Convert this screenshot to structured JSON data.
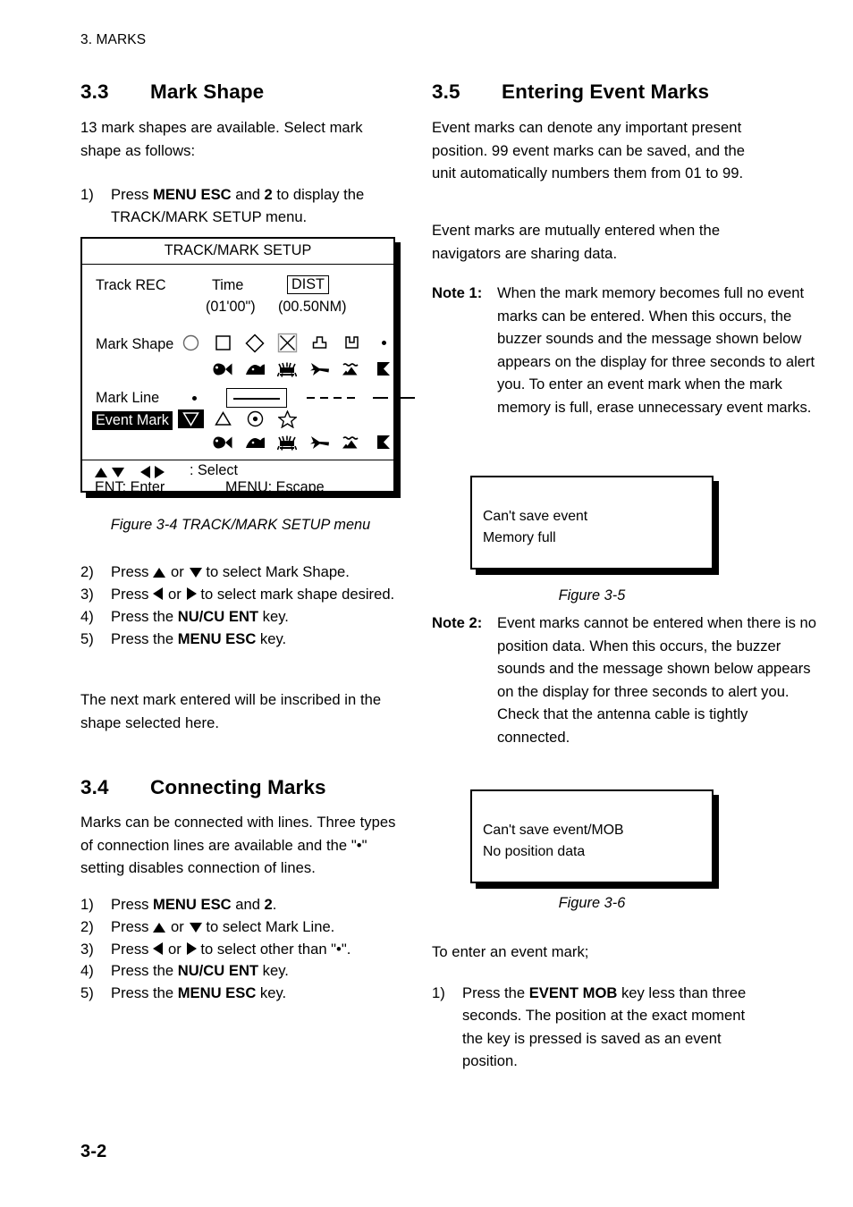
{
  "page": {
    "running_header": "3. MARKS",
    "page_number": "3-2"
  },
  "left_column": {
    "section_33": {
      "number": "3.3",
      "title": "Mark Shape",
      "intro": "13 mark shapes are available. Select mark shape as follows:",
      "step1_number": "1)",
      "step1_a": "Press ",
      "step1_b1": "MENU ESC",
      "step1_c": " and ",
      "step1_b2": "2",
      "step1_d": " to display the TRACK/MARK SETUP menu.",
      "figure_caption": "Figure 3-4 TRACK/MARK SETUP menu",
      "steps": [
        {
          "n": "2)",
          "pre": "Press ",
          "post": " to select Mark Shape.",
          "arrows": "up_or_down"
        },
        {
          "n": "3)",
          "pre": "Press ",
          "post": " to select mark shape desired.",
          "arrows": "left_or_right"
        },
        {
          "n": "4)",
          "pre": "Press the ",
          "bold": "NU/CU ENT",
          "post": " key."
        },
        {
          "n": "5)",
          "pre": "Press the ",
          "bold": "MENU ESC",
          "post": " key."
        }
      ],
      "outro": "The next mark entered will be inscribed in the shape selected here."
    },
    "section_34": {
      "number": "3.4",
      "title": "Connecting Marks",
      "intro": "Marks can be connected with lines. Three types of connection lines are available and the \"•\" setting disables connection of lines.",
      "steps": [
        {
          "n": "1)",
          "pre": "Press ",
          "bold": "MENU ESC",
          "post": " and ",
          "bold2": "2",
          "post2": "."
        },
        {
          "n": "2)",
          "pre": "Press ",
          "post": " to select Mark Line.",
          "arrows": "up_or_down"
        },
        {
          "n": "3)",
          "pre": "Press ",
          "post": " to select other than \"•\".",
          "arrows": "left_or_right"
        },
        {
          "n": "4)",
          "pre": "Press the ",
          "bold": "NU/CU ENT",
          "post": " key."
        },
        {
          "n": "5)",
          "pre": "Press the ",
          "bold": "MENU ESC",
          "post": " key."
        }
      ],
      "word_or": "or"
    }
  },
  "menu_figure": {
    "title": "TRACK/MARK SETUP",
    "rows": {
      "track_rec_label": "Track REC",
      "track_rec_time": "Time",
      "track_rec_time_value": "(01'00\")",
      "track_rec_dist": "DIST",
      "track_rec_dist_value": "(00.50NM)",
      "mark_shape_label": "Mark Shape",
      "mark_line_label": "Mark Line",
      "event_mark_label": "Event Mark"
    },
    "mark_shape_icons": [
      "circle-icon",
      "square-icon",
      "diamond-icon",
      "crossed-square-icon",
      "buoy-icon",
      "wreck-icon",
      "dot-icon",
      "fish-icon",
      "dolphin-icon",
      "crab-icon",
      "bird-icon",
      "island-icon",
      "flag-icon"
    ],
    "mark_shape_selected_index": 3,
    "mark_line_icons": [
      "dot-icon",
      "solid-line-icon",
      "dotted-line-icon",
      "dashed-line-icon"
    ],
    "mark_line_selected_index": 1,
    "event_mark_icons": [
      "down-triangle-icon",
      "up-triangle-icon",
      "target-circle-icon",
      "star-icon",
      "fish-icon",
      "dolphin-icon",
      "crab-icon",
      "bird-icon",
      "island-icon",
      "flag-icon"
    ],
    "event_mark_selected_index": 0,
    "footer": {
      "select_label": ": Select",
      "enter_label": "ENT: Enter",
      "escape_label": "MENU: Escape"
    }
  },
  "right_column": {
    "section_35": {
      "number": "3.5",
      "title": "Entering Event Marks",
      "para1": "Event marks can denote any important present position. 99 event marks can be saved, and the unit automatically numbers them from 01 to 99.",
      "para2": "Event marks are mutually entered when the navigators are sharing data.",
      "note1_label": "Note 1:",
      "note1_text": "When the mark memory becomes full no event marks can be entered. When this occurs, the buzzer sounds and the message shown below appears on the display for three seconds to alert you. To enter an event mark when the mark memory is full, erase unnecessary event marks.",
      "figure35_caption": "Figure 3-5",
      "note2_label": "Note 2:",
      "note2_text": "Event marks cannot be entered when there is no position data. When this occurs, the buzzer sounds and the message shown below appears on the display for three seconds to alert you. Check that the antenna cable is tightly connected.",
      "figure36_caption": "Figure 3-6",
      "outro": "To enter an event mark;",
      "final_step": {
        "n": "1)",
        "pre": "Press the ",
        "bold": "EVENT MOB",
        "post": " key less than three seconds. The position at the exact moment the key is pressed is saved as an event position."
      }
    },
    "message_box_1": {
      "line1": "Can't save event",
      "line2": "Memory full"
    },
    "message_box_2": {
      "line1": "Can't save event/MOB",
      "line2": "No position data"
    }
  }
}
